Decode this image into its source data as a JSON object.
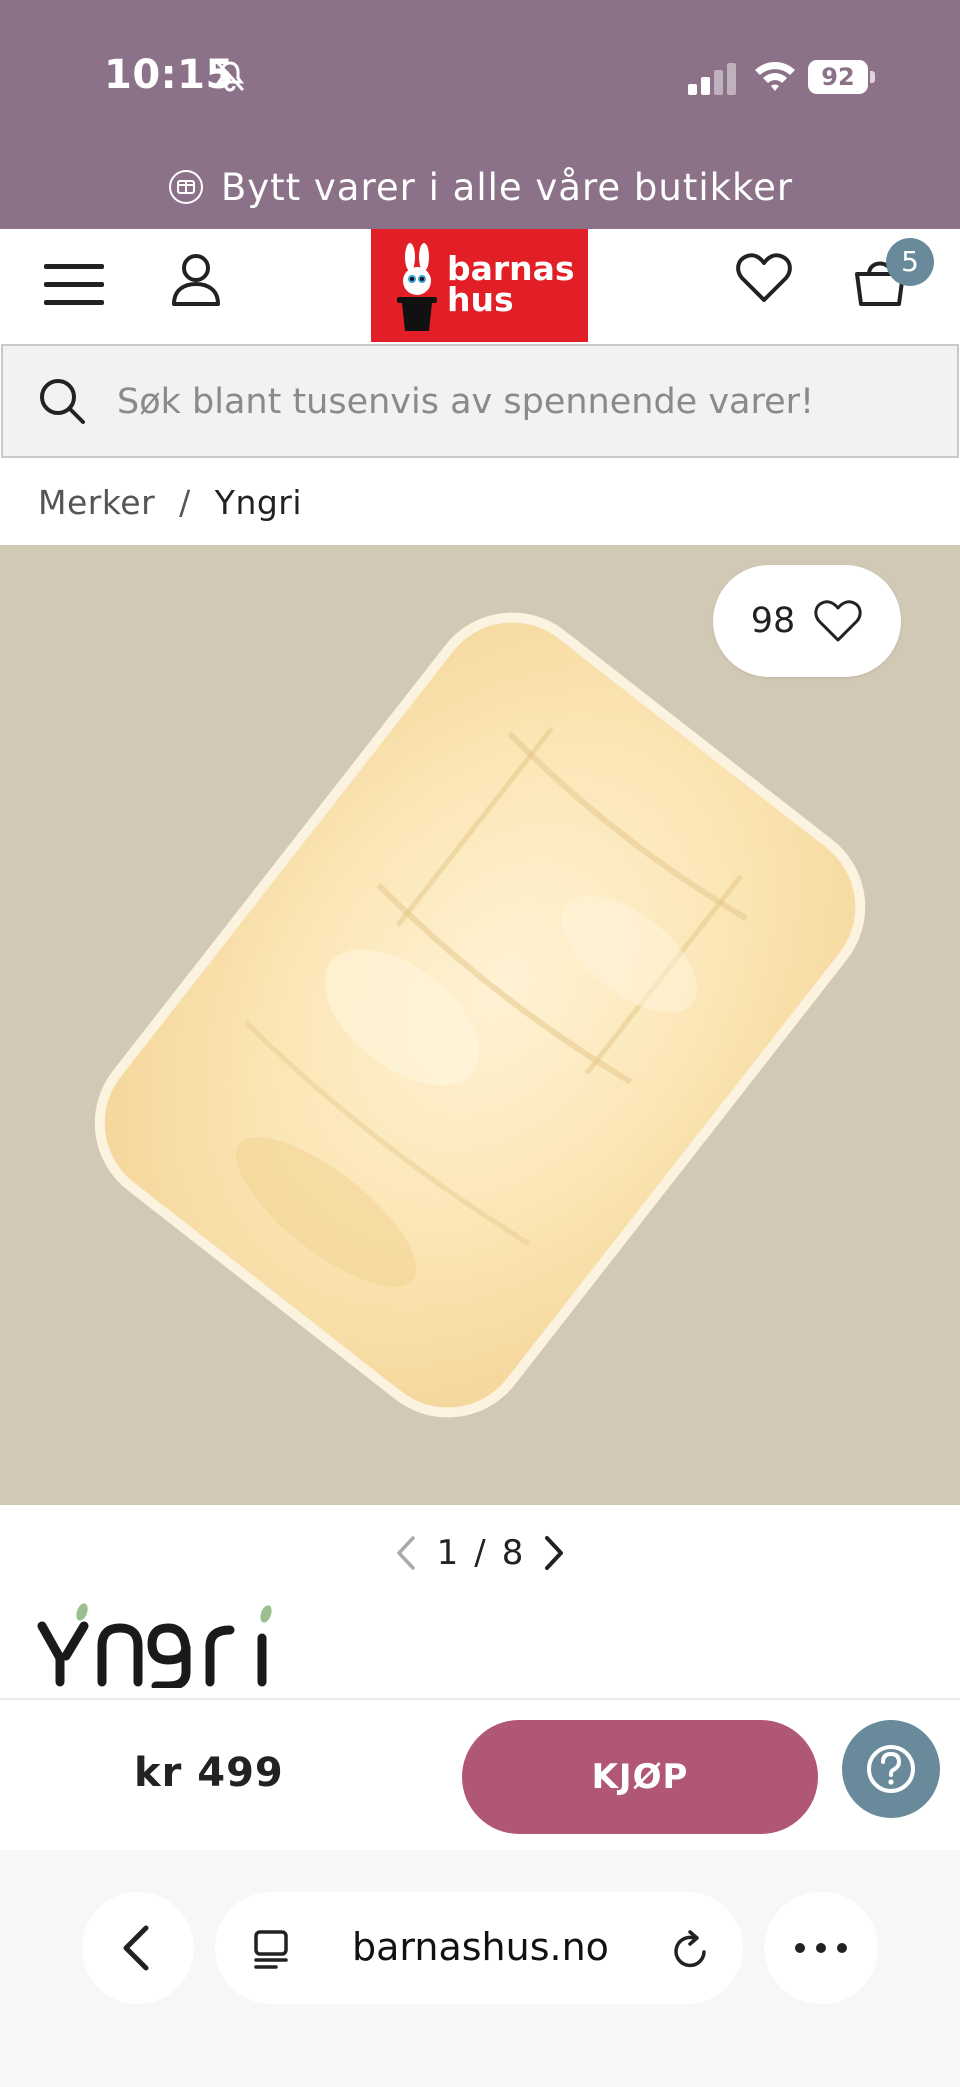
{
  "status_bar": {
    "time": "10:15",
    "battery": "92"
  },
  "promo": {
    "text": "Bytt varer i alle våre butikker"
  },
  "header": {
    "logo_line1": "barnas",
    "logo_line2": "hus",
    "cart_count": "5"
  },
  "search": {
    "placeholder": "Søk blant tusenvis av spennende varer!"
  },
  "breadcrumb": {
    "items": [
      "Merker",
      "Yngri"
    ],
    "separator": "/"
  },
  "product": {
    "favorites_count": "98",
    "image_page": "1",
    "image_total": "8",
    "page_separator": "/",
    "brand_logo_text": "Yngri",
    "price": "kr 499",
    "buy_label": "KJØP"
  },
  "browser": {
    "url": "barnashus.no"
  },
  "colors": {
    "top_bar": "#8b7289",
    "logo_red": "#e21f26",
    "buy_button": "#b05775",
    "accent_blue": "#688a9a",
    "image_bg": "#d1c9b5"
  },
  "icons": [
    "bell-off-icon",
    "signal-icon",
    "wifi-icon",
    "battery-icon",
    "exchange-icon",
    "menu-icon",
    "user-icon",
    "heart-icon",
    "cart-icon",
    "search-icon",
    "chevron-left-icon",
    "chevron-right-icon",
    "help-icon",
    "back-icon",
    "tabs-icon",
    "reload-icon",
    "more-icon"
  ]
}
